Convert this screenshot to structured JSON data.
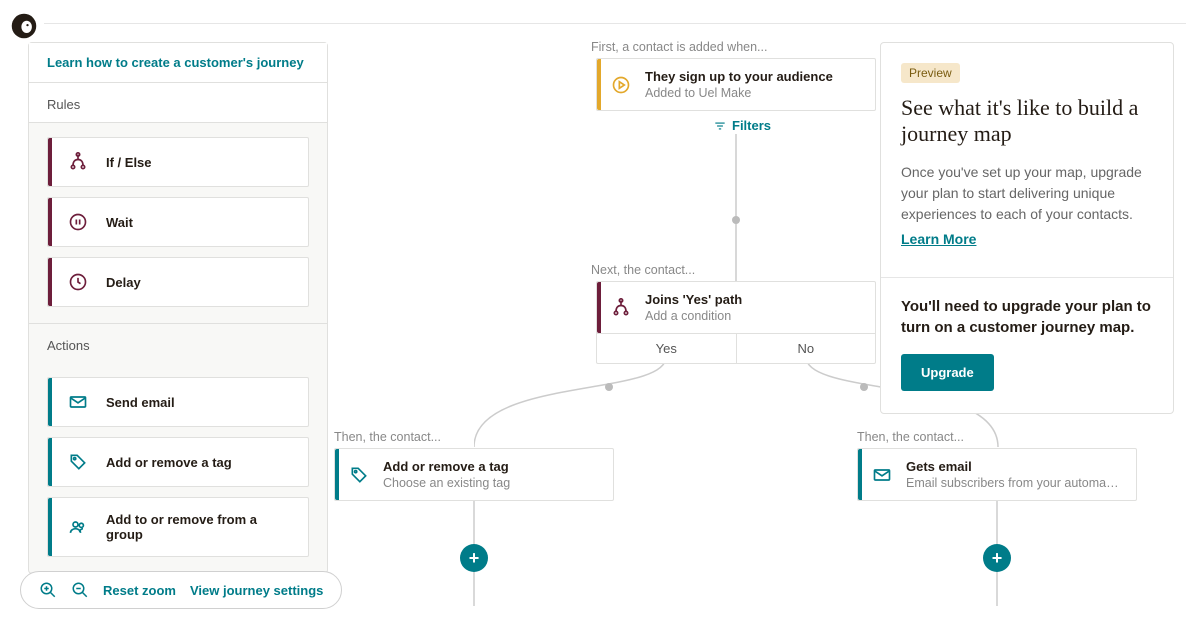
{
  "sidebar": {
    "learn_link": "Learn how to create a customer's journey",
    "rules_title": "Rules",
    "rules": [
      {
        "label": "If / Else"
      },
      {
        "label": "Wait"
      },
      {
        "label": "Delay"
      }
    ],
    "actions_title": "Actions",
    "actions": [
      {
        "label": "Send email"
      },
      {
        "label": "Add or remove a tag"
      },
      {
        "label": "Add to or remove from a group"
      }
    ]
  },
  "journey": {
    "hint_first": "First, a contact is added when...",
    "start": {
      "title": "They sign up to your audience",
      "sub": "Added to Uel Make"
    },
    "filters_label": "Filters",
    "hint_next": "Next, the contact...",
    "branch": {
      "title": "Joins 'Yes' path",
      "sub": "Add a condition",
      "yes": "Yes",
      "no": "No"
    },
    "hint_then_left": "Then, the contact...",
    "hint_then_right": "Then, the contact...",
    "tag_node": {
      "title": "Add or remove a tag",
      "sub": "Choose an existing tag"
    },
    "email_node": {
      "title": "Gets email",
      "sub": "Email subscribers from your automation..."
    }
  },
  "preview": {
    "badge": "Preview",
    "title": "See what it's like to build a journey map",
    "desc": "Once you've set up your map, upgrade your plan to start delivering unique experiences to each of your contacts.",
    "learn_more": "Learn More",
    "note": "You'll need to upgrade your plan to turn on a customer journey map.",
    "upgrade": "Upgrade"
  },
  "bottom": {
    "reset": "Reset zoom",
    "settings": "View journey settings"
  }
}
